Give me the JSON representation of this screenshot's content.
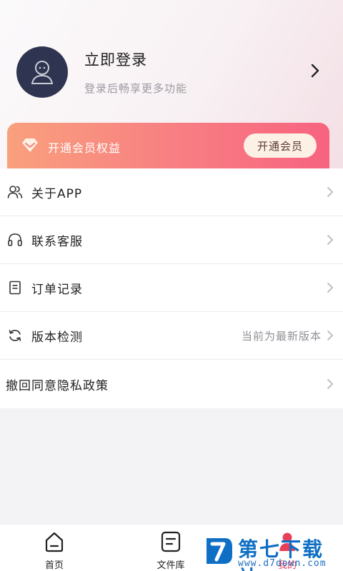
{
  "profile": {
    "title": "立即登录",
    "subtitle": "登录后畅享更多功能"
  },
  "vip": {
    "label": "开通会员权益",
    "button": "开通会员"
  },
  "menu": [
    {
      "label": "关于APP",
      "icon": "users-icon",
      "value": ""
    },
    {
      "label": "联系客服",
      "icon": "headset-icon",
      "value": ""
    },
    {
      "label": "订单记录",
      "icon": "document-icon",
      "value": ""
    },
    {
      "label": "版本检测",
      "icon": "refresh-icon",
      "value": "当前为最新版本"
    },
    {
      "label": "撤回同意隐私政策",
      "icon": "",
      "value": ""
    }
  ],
  "tabs": [
    {
      "label": "首页",
      "icon": "home-icon"
    },
    {
      "label": "文件库",
      "icon": "file-library-icon"
    },
    {
      "label": "我的",
      "icon": "profile-icon",
      "active": true
    }
  ],
  "watermark": {
    "text": "第七下载站",
    "url": "www.d7down.com"
  },
  "colors": {
    "accent": "#e8405a",
    "vip_gradient_start": "#f9a07d",
    "vip_gradient_end": "#f7637f",
    "avatar_bg": "#2f3550"
  }
}
